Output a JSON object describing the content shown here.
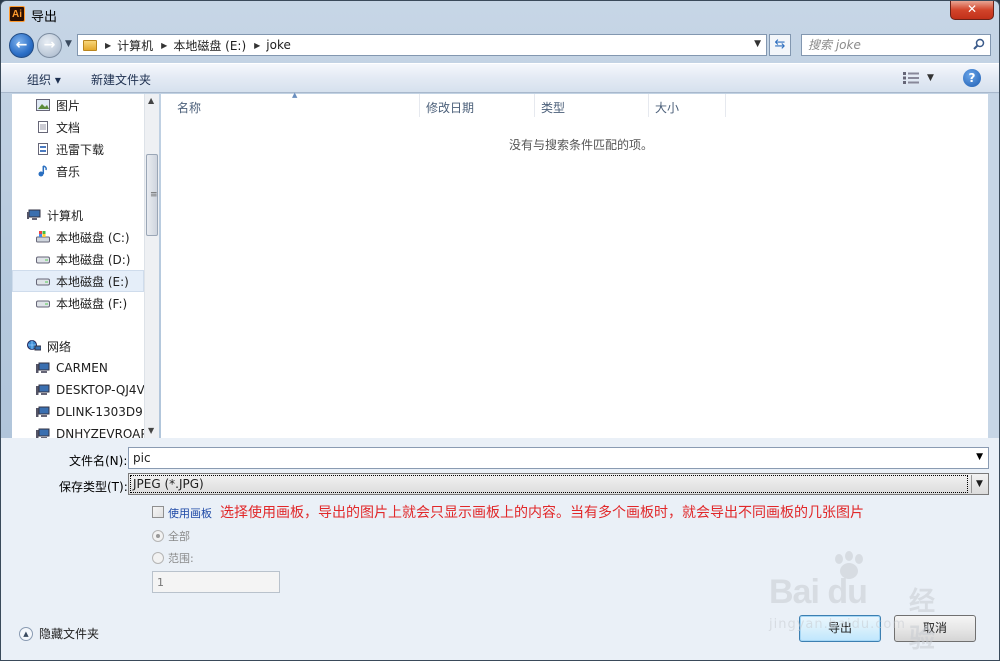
{
  "window": {
    "app_icon_text": "Ai",
    "title": "导出",
    "close_symbol": "✕"
  },
  "nav": {
    "breadcrumb": [
      "计算机",
      "本地磁盘 (E:)",
      "joke"
    ],
    "search_placeholder": "搜索 joke"
  },
  "toolbar": {
    "organize": "组织 ▾",
    "new_folder": "新建文件夹"
  },
  "sidebar": {
    "items": [
      {
        "label": "图片",
        "icon": "pictures-icon",
        "kind": "item"
      },
      {
        "label": "文档",
        "icon": "documents-icon",
        "kind": "item"
      },
      {
        "label": "迅雷下载",
        "icon": "downloads-icon",
        "kind": "item"
      },
      {
        "label": "音乐",
        "icon": "music-icon",
        "kind": "item"
      },
      {
        "label": "计算机",
        "icon": "computer-icon",
        "kind": "group"
      },
      {
        "label": "本地磁盘 (C:)",
        "icon": "system-drive-icon",
        "kind": "item"
      },
      {
        "label": "本地磁盘 (D:)",
        "icon": "drive-icon",
        "kind": "item"
      },
      {
        "label": "本地磁盘 (E:)",
        "icon": "drive-icon",
        "kind": "item",
        "selected": true
      },
      {
        "label": "本地磁盘 (F:)",
        "icon": "drive-icon",
        "kind": "item"
      },
      {
        "label": "网络",
        "icon": "network-icon",
        "kind": "group"
      },
      {
        "label": "CARMEN",
        "icon": "network-computer-icon",
        "kind": "item"
      },
      {
        "label": "DESKTOP-QJ4V",
        "icon": "network-computer-icon",
        "kind": "item"
      },
      {
        "label": "DLINK-1303D9",
        "icon": "network-computer-icon",
        "kind": "item"
      },
      {
        "label": "DNHYZEVROAP",
        "icon": "network-computer-icon",
        "kind": "item"
      }
    ]
  },
  "filelist": {
    "columns": [
      "名称",
      "修改日期",
      "类型",
      "大小"
    ],
    "empty_message": "没有与搜索条件匹配的项。"
  },
  "form": {
    "filename_label": "文件名(N):",
    "filename_value": "pic",
    "filetype_label": "保存类型(T):",
    "filetype_value": "JPEG (*.JPG)",
    "use_artboards_label": "使用画板",
    "annotation": "选择使用画板，导出的图片上就会只显示画板上的内容。当有多个画板时，就会导出不同画板的几张图片",
    "all_label": "全部",
    "range_label": "范围:",
    "range_value": "1",
    "hide_folders_label": "隐藏文件夹",
    "export_button": "导出",
    "cancel_button": "取消"
  },
  "watermark": {
    "logo": "Bai du",
    "text": "经验",
    "url": "jingyan.baidu.com"
  },
  "colors": {
    "annotation": "#e1282a",
    "link_blue": "#1f4aa7",
    "selected_row": "#e5eef9"
  }
}
